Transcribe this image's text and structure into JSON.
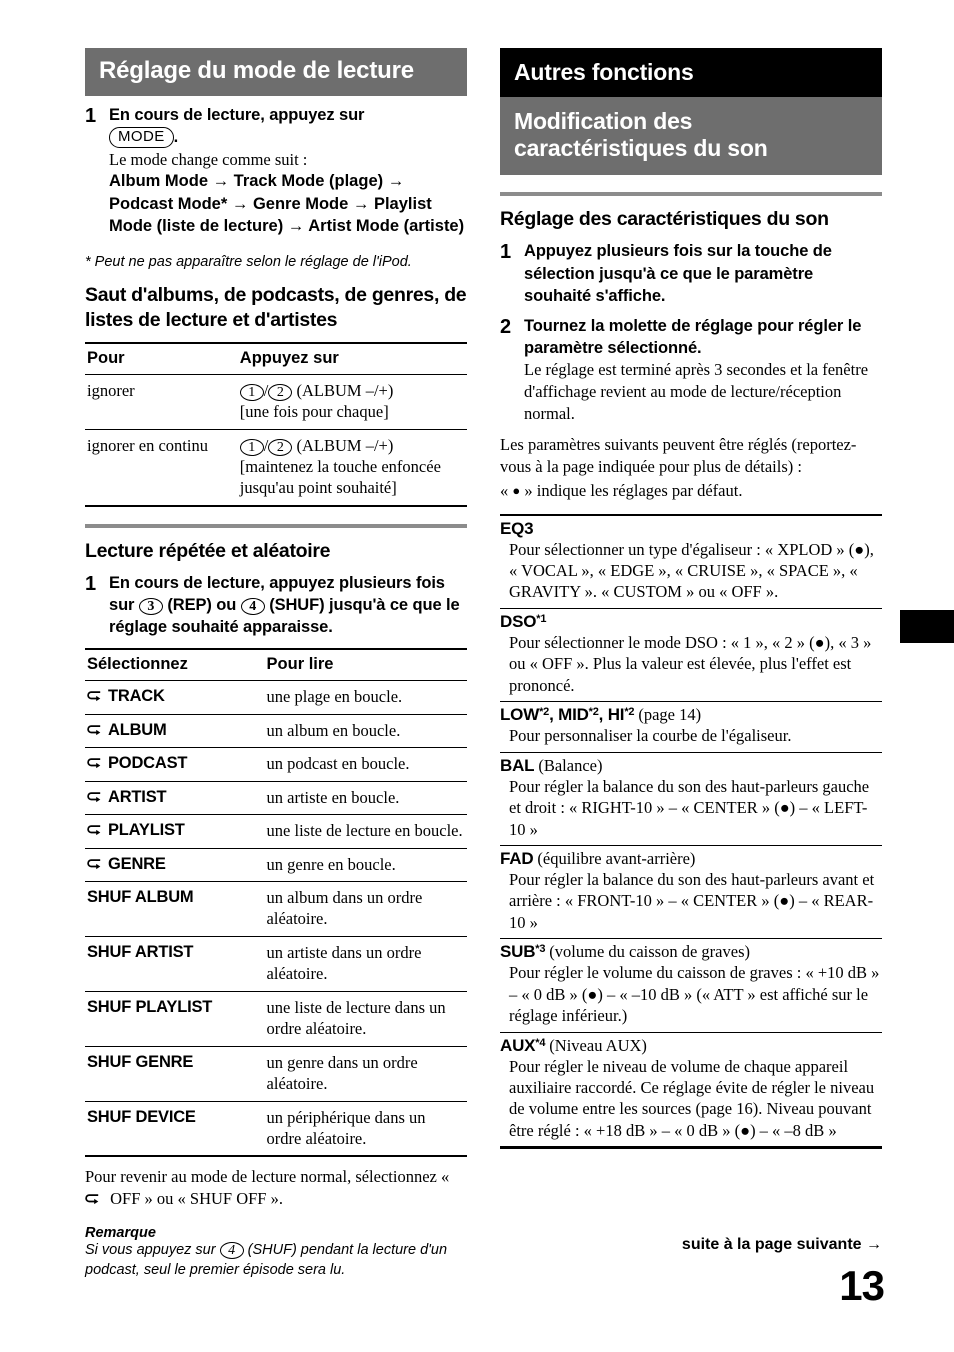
{
  "left": {
    "banner": "Réglage du mode de lecture",
    "step1": {
      "num": "1",
      "title_before": "En cours de lecture, appuyez sur",
      "keycap": "MODE",
      "title_after": ".",
      "sub": "Le mode change comme suit :",
      "sequence": "Album Mode → Track Mode (plage) → Podcast Mode* → Genre Mode → Playlist Mode (liste de lecture) → Artist Mode (artiste)"
    },
    "footnote": "* Peut ne pas apparaître selon le réglage de l'iPod.",
    "skip": {
      "heading": "Saut d'albums, de podcasts, de genres, de listes de lecture et d'artistes",
      "col1": "Pour",
      "col2": "Appuyez sur",
      "rows": [
        {
          "key": "ignorer",
          "keys": [
            "1",
            "2"
          ],
          "label": "(ALBUM –/+)",
          "detail": "[une fois pour chaque]"
        },
        {
          "key": "ignorer en continu",
          "keys": [
            "1",
            "2"
          ],
          "label": "(ALBUM –/+)",
          "detail": "[maintenez la touche enfoncée jusqu'au point souhaité]"
        }
      ]
    },
    "repeat": {
      "heading": "Lecture répétée et aléatoire",
      "step": {
        "num": "1",
        "p1": "En cours de lecture, appuyez plusieurs fois sur",
        "k1": "3",
        "p2": "(REP) ou",
        "k2": "4",
        "p3": "(SHUF) jusqu'à ce que le réglage souhaité apparaisse."
      },
      "col1": "Sélectionnez",
      "col2": "Pour lire",
      "rows": [
        {
          "icon": "repeat-icon",
          "name": "TRACK",
          "desc": "une plage en boucle."
        },
        {
          "icon": "repeat-icon",
          "name": "ALBUM",
          "desc": "un album en boucle."
        },
        {
          "icon": "repeat-icon",
          "name": "PODCAST",
          "desc": "un podcast en boucle."
        },
        {
          "icon": "repeat-icon",
          "name": "ARTIST",
          "desc": "un artiste en boucle."
        },
        {
          "icon": "repeat-icon",
          "name": "PLAYLIST",
          "desc": "une liste de lecture en boucle."
        },
        {
          "icon": "repeat-icon",
          "name": "GENRE",
          "desc": "un genre en boucle."
        },
        {
          "icon": "",
          "name": "SHUF ALBUM",
          "desc": "un album dans un ordre aléatoire."
        },
        {
          "icon": "",
          "name": "SHUF ARTIST",
          "desc": "un artiste dans un ordre aléatoire."
        },
        {
          "icon": "",
          "name": "SHUF PLAYLIST",
          "desc": "une liste de lecture dans un ordre aléatoire."
        },
        {
          "icon": "",
          "name": "SHUF GENRE",
          "desc": "un genre dans un ordre aléatoire."
        },
        {
          "icon": "",
          "name": "SHUF DEVICE",
          "desc": "un périphérique dans un ordre aléatoire."
        }
      ],
      "after_a": "Pour revenir au mode de lecture normal, sélectionnez «",
      "after_b": "OFF » ou « SHUF OFF ».",
      "note_title": "Remarque",
      "note_a": "Si vous appuyez sur",
      "note_key": "4",
      "note_b": "(SHUF) pendant la lecture d'un podcast, seul le premier épisode sera lu."
    }
  },
  "right": {
    "banner_black": "Autres fonctions",
    "banner_gray": "Modification des caractéristiques du son",
    "heading": "Réglage des caractéristiques du son",
    "steps": [
      {
        "num": "1",
        "title": "Appuyez plusieurs fois sur la touche de sélection jusqu'à ce que le paramètre souhaité s'affiche.",
        "sub": ""
      },
      {
        "num": "2",
        "title": "Tournez la molette de réglage pour régler le paramètre sélectionné.",
        "sub": "Le réglage est terminé après 3 secondes et la fenêtre d'affichage revient au mode de lecture/réception normal."
      }
    ],
    "intro": "Les paramètres suivants peuvent être réglés (reportez-vous à la page indiquée pour plus de détails) :",
    "default_note_a": "«",
    "default_note_b": "» indique les réglages par défaut.",
    "params": [
      {
        "name": "EQ3",
        "sup": "",
        "paren": "",
        "desc": "Pour sélectionner un type d'égaliseur : « XPLOD » (●), « VOCAL », « EDGE », « CRUISE », « SPACE », « GRAVITY ». « CUSTOM » ou « OFF »."
      },
      {
        "name": "DSO",
        "sup": "*1",
        "paren": "",
        "desc": "Pour sélectionner le mode DSO : « 1 », « 2 » (●), « 3 » ou « OFF ». Plus la valeur est élevée, plus l'effet est prononcé."
      },
      {
        "name": "LOW*2, MID*2, HI*2",
        "sup": "",
        "paren": "(page 14)",
        "desc": "Pour personnaliser la courbe de l'égaliseur."
      },
      {
        "name": "BAL",
        "sup": "",
        "paren": "(Balance)",
        "desc": "Pour régler la balance du son des haut-parleurs gauche et droit : « RIGHT-10 » – « CENTER » (●) – « LEFT-10 »"
      },
      {
        "name": "FAD",
        "sup": "",
        "paren": "(équilibre avant-arrière)",
        "desc": "Pour régler la balance du son des haut-parleurs avant et arrière : « FRONT-10 » – « CENTER » (●) – « REAR-10 »"
      },
      {
        "name": "SUB",
        "sup": "*3",
        "paren": "(volume du caisson de graves)",
        "desc": "Pour régler le volume du caisson de graves : « +10 dB » – « 0 dB » (●) – « –10 dB » (« ATT » est affiché sur le réglage inférieur.)"
      },
      {
        "name": "AUX",
        "sup": "*4",
        "paren": "(Niveau AUX)",
        "desc": "Pour régler le niveau de volume de chaque appareil auxiliaire raccordé. Ce réglage évite de régler le niveau de volume entre les sources (page 16). Niveau pouvant être réglé : « +18 dB » – « 0 dB » (●) – « –8 dB »"
      }
    ]
  },
  "footer": {
    "continued": "suite à la page suivante →",
    "page_number": "13"
  },
  "colors": {
    "band_gray": "#6e6e6e",
    "band_black": "#000000",
    "rule": "#8a8a8a"
  }
}
